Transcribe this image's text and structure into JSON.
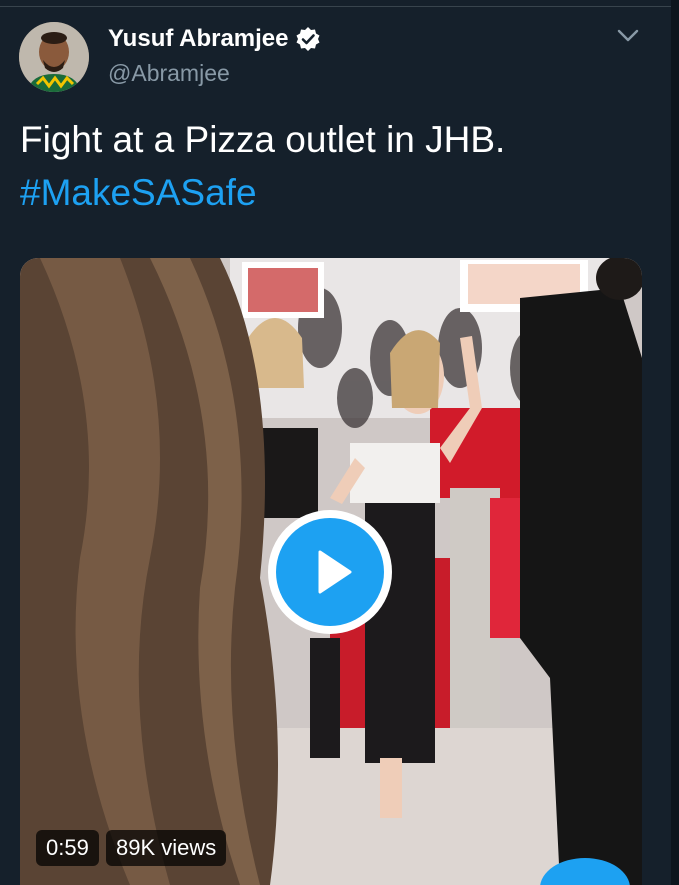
{
  "author": {
    "name": "Yusuf Abramjee",
    "handle": "@Abramjee",
    "verified": true
  },
  "tweet": {
    "text": "Fight at a Pizza outlet in JHB.",
    "hashtag": "#MakeSASafe"
  },
  "video": {
    "duration": "0:59",
    "views": "89K views",
    "play_icon": "play-icon"
  },
  "menu": {
    "icon": "chevron-down-icon"
  },
  "colors": {
    "background": "#15202b",
    "accent": "#1da1f2",
    "secondary_text": "#8899a6"
  }
}
